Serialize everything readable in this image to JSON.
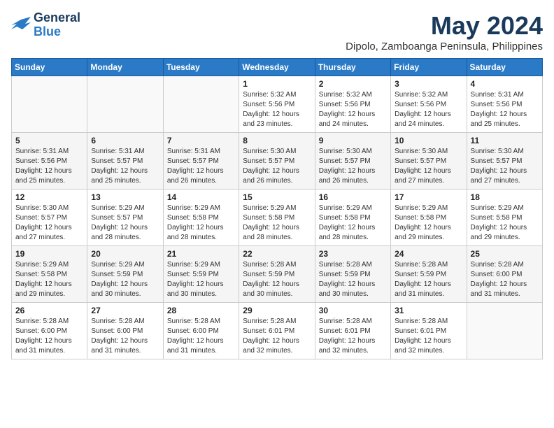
{
  "logo": {
    "line1": "General",
    "line2": "Blue"
  },
  "title": "May 2024",
  "subtitle": "Dipolo, Zamboanga Peninsula, Philippines",
  "weekdays": [
    "Sunday",
    "Monday",
    "Tuesday",
    "Wednesday",
    "Thursday",
    "Friday",
    "Saturday"
  ],
  "weeks": [
    [
      {
        "day": "",
        "info": ""
      },
      {
        "day": "",
        "info": ""
      },
      {
        "day": "",
        "info": ""
      },
      {
        "day": "1",
        "info": "Sunrise: 5:32 AM\nSunset: 5:56 PM\nDaylight: 12 hours\nand 23 minutes."
      },
      {
        "day": "2",
        "info": "Sunrise: 5:32 AM\nSunset: 5:56 PM\nDaylight: 12 hours\nand 24 minutes."
      },
      {
        "day": "3",
        "info": "Sunrise: 5:32 AM\nSunset: 5:56 PM\nDaylight: 12 hours\nand 24 minutes."
      },
      {
        "day": "4",
        "info": "Sunrise: 5:31 AM\nSunset: 5:56 PM\nDaylight: 12 hours\nand 25 minutes."
      }
    ],
    [
      {
        "day": "5",
        "info": "Sunrise: 5:31 AM\nSunset: 5:56 PM\nDaylight: 12 hours\nand 25 minutes."
      },
      {
        "day": "6",
        "info": "Sunrise: 5:31 AM\nSunset: 5:57 PM\nDaylight: 12 hours\nand 25 minutes."
      },
      {
        "day": "7",
        "info": "Sunrise: 5:31 AM\nSunset: 5:57 PM\nDaylight: 12 hours\nand 26 minutes."
      },
      {
        "day": "8",
        "info": "Sunrise: 5:30 AM\nSunset: 5:57 PM\nDaylight: 12 hours\nand 26 minutes."
      },
      {
        "day": "9",
        "info": "Sunrise: 5:30 AM\nSunset: 5:57 PM\nDaylight: 12 hours\nand 26 minutes."
      },
      {
        "day": "10",
        "info": "Sunrise: 5:30 AM\nSunset: 5:57 PM\nDaylight: 12 hours\nand 27 minutes."
      },
      {
        "day": "11",
        "info": "Sunrise: 5:30 AM\nSunset: 5:57 PM\nDaylight: 12 hours\nand 27 minutes."
      }
    ],
    [
      {
        "day": "12",
        "info": "Sunrise: 5:30 AM\nSunset: 5:57 PM\nDaylight: 12 hours\nand 27 minutes."
      },
      {
        "day": "13",
        "info": "Sunrise: 5:29 AM\nSunset: 5:57 PM\nDaylight: 12 hours\nand 28 minutes."
      },
      {
        "day": "14",
        "info": "Sunrise: 5:29 AM\nSunset: 5:58 PM\nDaylight: 12 hours\nand 28 minutes."
      },
      {
        "day": "15",
        "info": "Sunrise: 5:29 AM\nSunset: 5:58 PM\nDaylight: 12 hours\nand 28 minutes."
      },
      {
        "day": "16",
        "info": "Sunrise: 5:29 AM\nSunset: 5:58 PM\nDaylight: 12 hours\nand 28 minutes."
      },
      {
        "day": "17",
        "info": "Sunrise: 5:29 AM\nSunset: 5:58 PM\nDaylight: 12 hours\nand 29 minutes."
      },
      {
        "day": "18",
        "info": "Sunrise: 5:29 AM\nSunset: 5:58 PM\nDaylight: 12 hours\nand 29 minutes."
      }
    ],
    [
      {
        "day": "19",
        "info": "Sunrise: 5:29 AM\nSunset: 5:58 PM\nDaylight: 12 hours\nand 29 minutes."
      },
      {
        "day": "20",
        "info": "Sunrise: 5:29 AM\nSunset: 5:59 PM\nDaylight: 12 hours\nand 30 minutes."
      },
      {
        "day": "21",
        "info": "Sunrise: 5:29 AM\nSunset: 5:59 PM\nDaylight: 12 hours\nand 30 minutes."
      },
      {
        "day": "22",
        "info": "Sunrise: 5:28 AM\nSunset: 5:59 PM\nDaylight: 12 hours\nand 30 minutes."
      },
      {
        "day": "23",
        "info": "Sunrise: 5:28 AM\nSunset: 5:59 PM\nDaylight: 12 hours\nand 30 minutes."
      },
      {
        "day": "24",
        "info": "Sunrise: 5:28 AM\nSunset: 5:59 PM\nDaylight: 12 hours\nand 31 minutes."
      },
      {
        "day": "25",
        "info": "Sunrise: 5:28 AM\nSunset: 6:00 PM\nDaylight: 12 hours\nand 31 minutes."
      }
    ],
    [
      {
        "day": "26",
        "info": "Sunrise: 5:28 AM\nSunset: 6:00 PM\nDaylight: 12 hours\nand 31 minutes."
      },
      {
        "day": "27",
        "info": "Sunrise: 5:28 AM\nSunset: 6:00 PM\nDaylight: 12 hours\nand 31 minutes."
      },
      {
        "day": "28",
        "info": "Sunrise: 5:28 AM\nSunset: 6:00 PM\nDaylight: 12 hours\nand 31 minutes."
      },
      {
        "day": "29",
        "info": "Sunrise: 5:28 AM\nSunset: 6:01 PM\nDaylight: 12 hours\nand 32 minutes."
      },
      {
        "day": "30",
        "info": "Sunrise: 5:28 AM\nSunset: 6:01 PM\nDaylight: 12 hours\nand 32 minutes."
      },
      {
        "day": "31",
        "info": "Sunrise: 5:28 AM\nSunset: 6:01 PM\nDaylight: 12 hours\nand 32 minutes."
      },
      {
        "day": "",
        "info": ""
      }
    ]
  ]
}
